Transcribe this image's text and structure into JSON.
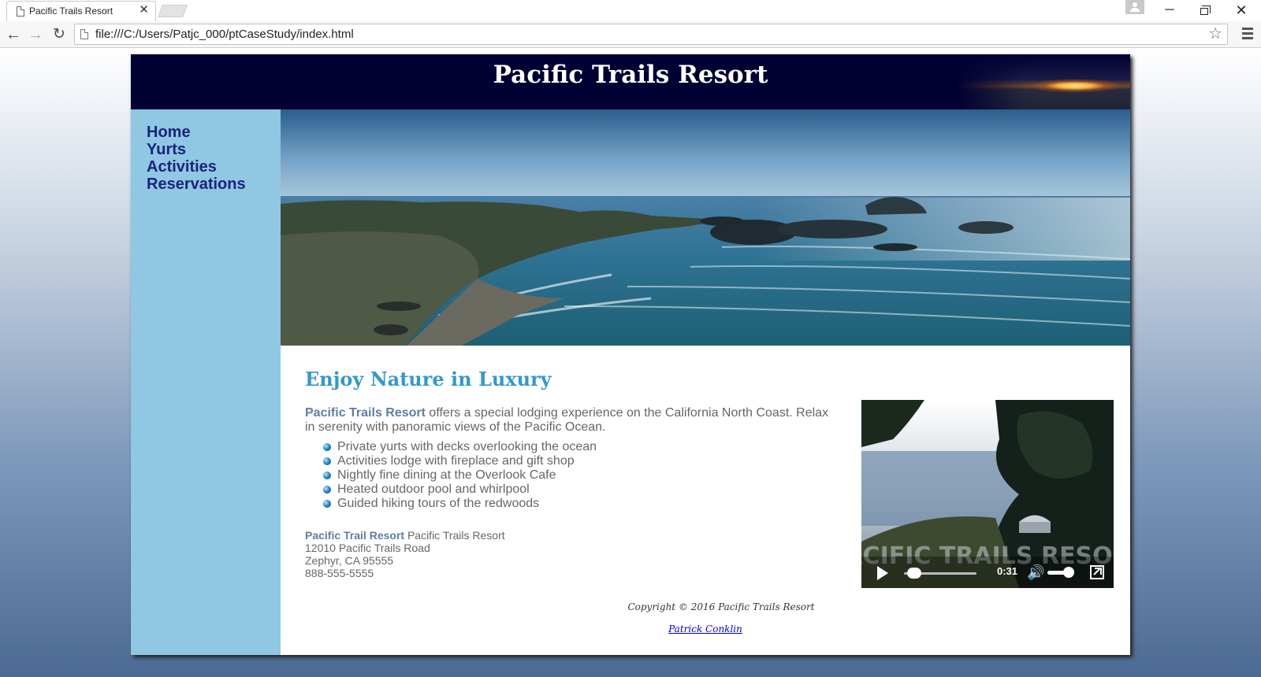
{
  "browser": {
    "tab_title": "Pacific Trails Resort",
    "tab_close": "✕",
    "url": "file:///C:/Users/Patjc_000/ptCaseStudy/index.html",
    "window_minimize": "─",
    "window_close": "✕",
    "nav_back": "←",
    "nav_forward": "→",
    "nav_reload": "↻",
    "star": "☆"
  },
  "site": {
    "title": "Pacific Trails Resort",
    "accent_color": "#3399cc",
    "header_color": "#000033",
    "nav_color": "#90c7e3"
  },
  "nav": {
    "items": [
      "Home",
      "Yurts",
      "Activities",
      "Reservations"
    ]
  },
  "content": {
    "heading": "Enjoy Nature in Luxury",
    "intro_name": "Pacific Trails Resort",
    "intro_text": "  offers a special lodging experience on the California North Coast. Relax in serenity with panoramic views of the Pacific Ocean.",
    "features": [
      "Private yurts with decks overlooking the ocean",
      "Activities lodge with fireplace and gift shop",
      "Nightly fine dining at the Overlook Cafe",
      "Heated outdoor pool and whirlpool",
      "Guided hiking tours of the redwoods"
    ],
    "contact": {
      "name_bold": "Pacific Trail Resort",
      "name_rest": " Pacific Trails Resort",
      "street": "12010 Pacific Trails Road",
      "city": "Zephyr, CA 95555",
      "phone": "888-555-5555"
    }
  },
  "video": {
    "time": "0:31",
    "progress": 0.05,
    "volume": 0.85,
    "overlay_text": "PACIFIC TRAILS RESORT"
  },
  "footer": {
    "copyright": "Copyright © 2016 Pacific Trails Resort",
    "author": "Patrick Conklin"
  }
}
